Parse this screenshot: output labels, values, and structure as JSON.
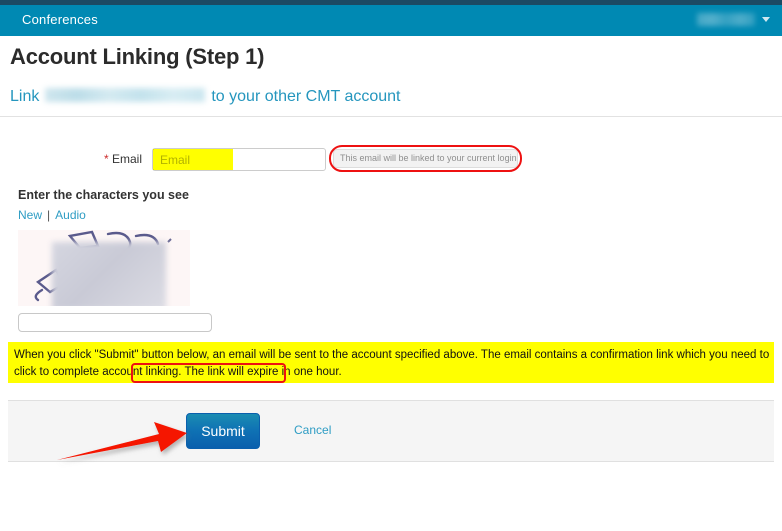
{
  "navbar": {
    "brand": "Conferences",
    "user_name_redacted": "",
    "caret_icon": "chevron-down-icon"
  },
  "page": {
    "title": "Account Linking (Step 1)",
    "link_line_prefix": "Link",
    "link_line_suffix": "to your other CMT account",
    "link_line_email_redacted": ""
  },
  "form": {
    "email_label": "Email",
    "required_marker": "*",
    "email_value": "",
    "email_placeholder": "Email",
    "email_hint": "This email will be linked to your current login account"
  },
  "captcha": {
    "prompt": "Enter the characters you see",
    "new_link": "New",
    "separator": "|",
    "audio_link": "Audio",
    "input_value": "",
    "input_placeholder": ""
  },
  "notice": {
    "text_part1": "When you click \"Submit\" button below, an email will be sent to the account specified above. The email contains a confirmation link which you need to click to complete account linking. ",
    "highlighted": "The link will expire in one hour."
  },
  "footer": {
    "submit_label": "Submit",
    "cancel_label": "Cancel"
  },
  "colors": {
    "navbar_teal": "#0089b3",
    "top_strip": "#1c4a63",
    "link_blue": "#2596be",
    "annotation_red": "#ee1111",
    "highlight_yellow": "#ffff00",
    "submit_gradient_top": "#1a8cb2",
    "submit_gradient_bottom": "#0a5fad",
    "footer_grey": "#f5f5f5"
  }
}
